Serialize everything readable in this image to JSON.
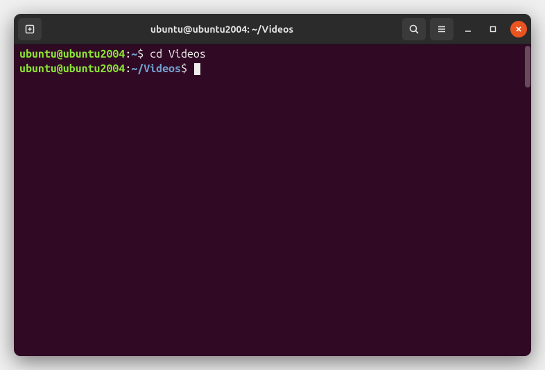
{
  "window": {
    "title": "ubuntu@ubuntu2004: ~/Videos"
  },
  "terminal": {
    "lines": [
      {
        "user": "ubuntu@ubuntu2004",
        "sep": ":",
        "path": "~",
        "dollar": "$ ",
        "command": "cd Videos"
      },
      {
        "user": "ubuntu@ubuntu2004",
        "sep": ":",
        "path": "~/Videos",
        "dollar": "$ ",
        "command": ""
      }
    ]
  }
}
